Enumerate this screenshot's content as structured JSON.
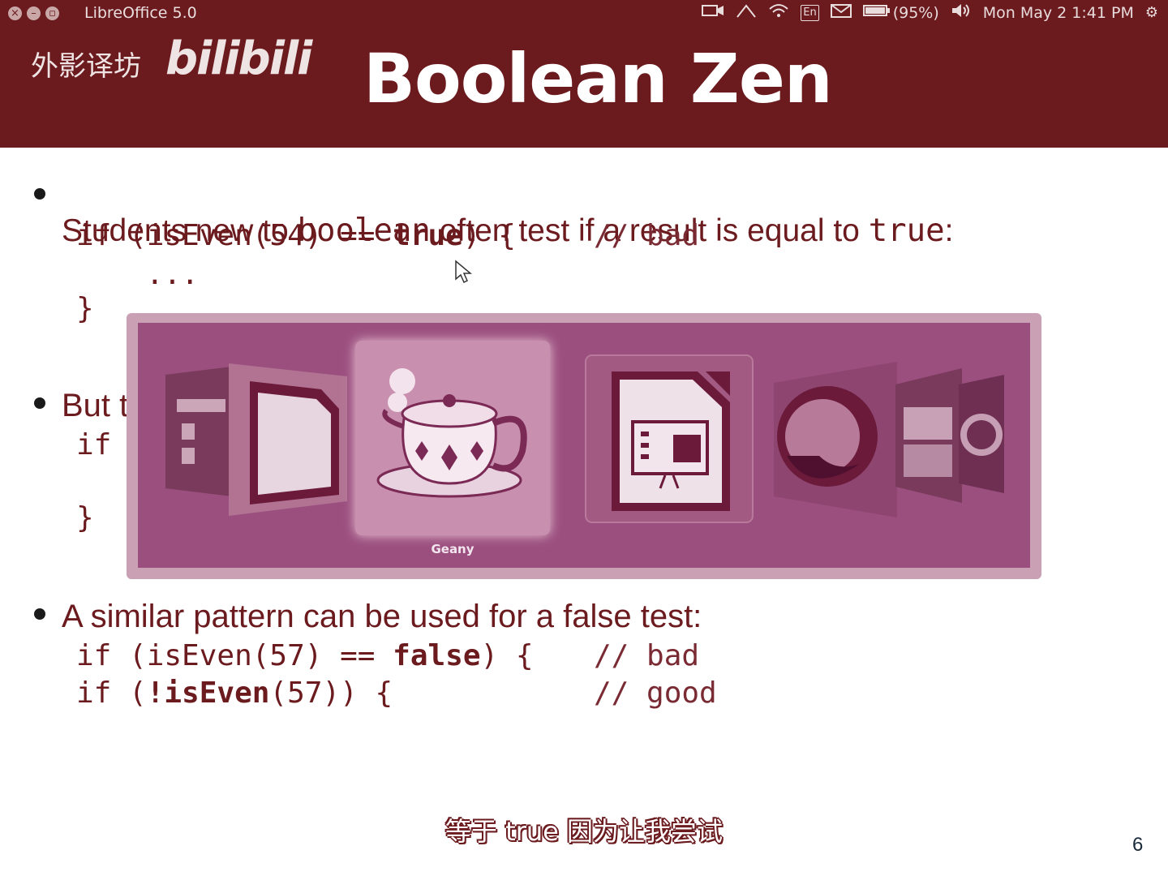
{
  "topbar": {
    "app_title": "LibreOffice 5.0",
    "battery": "(95%)",
    "keyboard": "En",
    "clock": "Mon May  2  1:41 PM"
  },
  "watermark": {
    "text": "外影译坊",
    "logo": "bilibili"
  },
  "slide": {
    "title": "Boolean Zen",
    "bullet1": {
      "prefix": "Students new to ",
      "kw1": "boolean",
      "middle": " often test if a result is equal to ",
      "kw2": "true",
      "suffix": ":"
    },
    "code1": {
      "line1_pre": "if (isEven(54) == ",
      "line1_kw": "true",
      "line1_post": ") {",
      "line1_comment": "// bad",
      "line2": "...",
      "line3": "}"
    },
    "bullet2_visible": "But t",
    "code2": {
      "line1_visible": "if (",
      "line3": "}"
    },
    "bullet3": {
      "text": "A similar pattern can be used for a false test:"
    },
    "code3": {
      "line1_pre": "if (isEven(57) == ",
      "line1_kw": "false",
      "line1_post": ") {",
      "line1_comment": "// bad",
      "line2_pre": "if (",
      "line2_kw": "!isEven",
      "line2_post": "(57)) {",
      "line2_comment": "// good"
    },
    "page_number": "6"
  },
  "switcher": {
    "selected_label": "Geany",
    "apps": [
      "files-icon",
      "libreoffice-writer-icon",
      "geany-icon",
      "libreoffice-impress-icon",
      "firefox-icon",
      "file-manager-icon",
      "settings-icon"
    ]
  },
  "subtitle": "等于 true 因为让我尝试",
  "colors": {
    "header": "#6b1a1e",
    "switcher_bg": "#9b4f7e",
    "text": "#6b1a1e"
  }
}
